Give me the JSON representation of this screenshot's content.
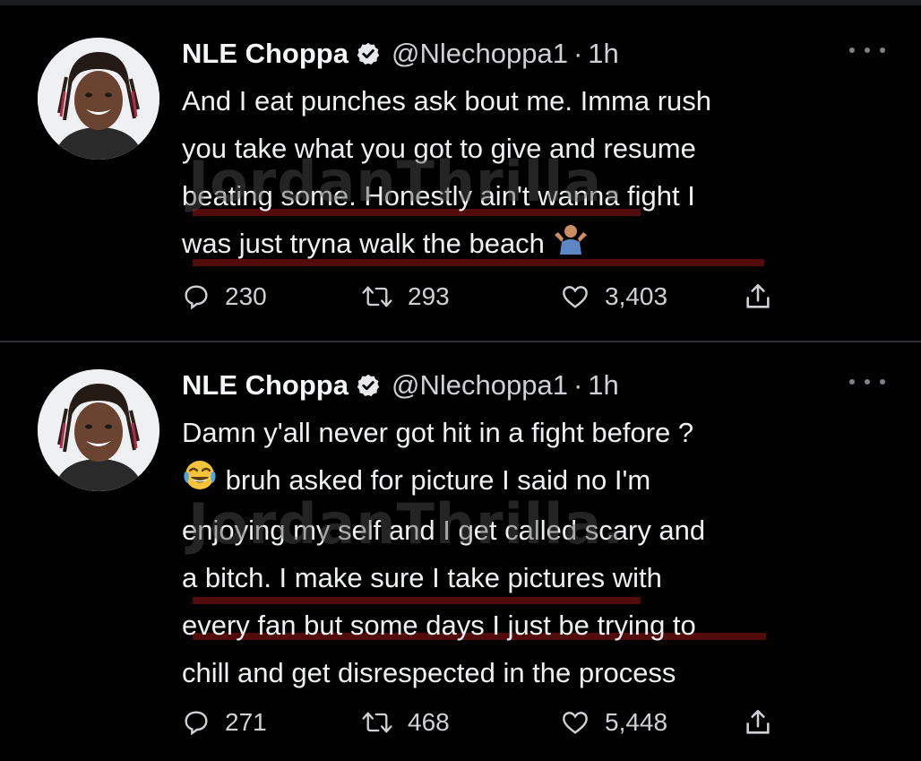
{
  "tweets": [
    {
      "author": "NLE Choppa",
      "handle": "@Nlechoppa1",
      "separator": "·",
      "time": "1h",
      "lines": [
        "And I eat punches ask bout me. Imma rush",
        "you take what you got to give and resume",
        "beating some. Honestly ain't wanna fight I",
        "was just tryna walk the beach"
      ],
      "emoji": "person-shrugging-emoji",
      "replies": "230",
      "retweets": "293",
      "likes": "3,403",
      "watermark": "JordanThrilla."
    },
    {
      "author": "NLE Choppa",
      "handle": "@Nlechoppa1",
      "separator": "·",
      "time": "1h",
      "lines": [
        "Damn y'all never got hit in a fight before ?",
        "bruh asked for picture I said no I'm",
        "enjoying my self and I get called scary and",
        "a bitch. I make sure I take pictures with",
        "every fan but some days I just be trying to",
        "chill and get disrespected in the process"
      ],
      "emoji": "face-with-tears-of-joy-emoji",
      "replies": "271",
      "retweets": "468",
      "likes": "5,448",
      "watermark": "JordanThrilla."
    }
  ],
  "colors": {
    "background": "#000000",
    "text": "#eef0f2",
    "muted": "#cfd1d4",
    "divider": "#2f3336",
    "underline": "#5c0d0d"
  }
}
